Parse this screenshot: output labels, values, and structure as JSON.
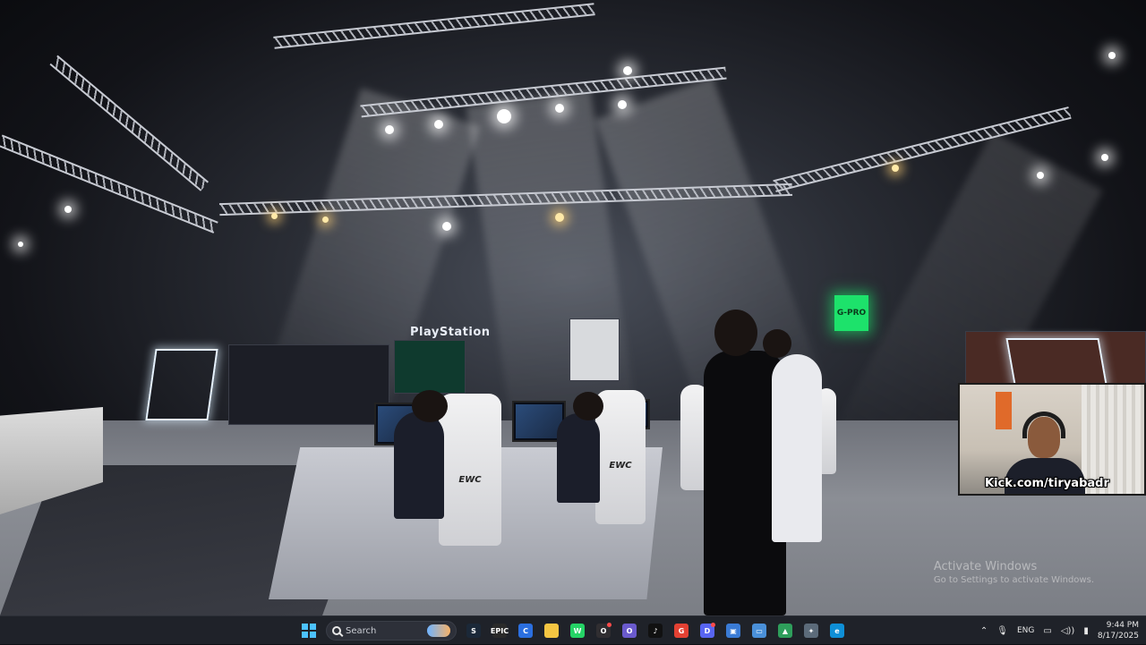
{
  "scene": {
    "sign_playstation": "PlayStation",
    "sign_green": "G-PRO",
    "chair_brand": "EWC"
  },
  "overlay": {
    "webcam_caption": "Kick.com/tiryabadr"
  },
  "watermark": {
    "title": "Activate Windows",
    "subtitle": "Go to Settings to activate Windows."
  },
  "taskbar": {
    "search_placeholder": "Search",
    "pinned": [
      {
        "name": "steam",
        "color": "#1b2838",
        "glyph": "S"
      },
      {
        "name": "epic-games",
        "color": "#2a2a2a",
        "glyph": "EPIC"
      },
      {
        "name": "copilot",
        "color": "#2b6fe0",
        "glyph": "C"
      },
      {
        "name": "file-explorer",
        "color": "#f4c542",
        "glyph": ""
      },
      {
        "name": "whatsapp",
        "color": "#25d366",
        "glyph": "W"
      },
      {
        "name": "obs",
        "color": "#302e31",
        "glyph": "O"
      },
      {
        "name": "cortana",
        "color": "#6a5acd",
        "glyph": "O"
      },
      {
        "name": "tiktok",
        "color": "#111",
        "glyph": "♪"
      },
      {
        "name": "chrome",
        "color": "#e34133",
        "glyph": "G"
      },
      {
        "name": "discord",
        "color": "#5865f2",
        "glyph": "D"
      },
      {
        "name": "app-blue",
        "color": "#3a7bd5",
        "glyph": "▣"
      },
      {
        "name": "app-window",
        "color": "#4a90d9",
        "glyph": "▭"
      },
      {
        "name": "app-green",
        "color": "#2e9e5b",
        "glyph": "▲"
      },
      {
        "name": "app-gear",
        "color": "#5c6b7a",
        "glyph": "✦"
      },
      {
        "name": "edge",
        "color": "#0f8fd6",
        "glyph": "e"
      }
    ],
    "language": "ENG",
    "time": "9:44 PM",
    "date": "8/17/2025"
  }
}
